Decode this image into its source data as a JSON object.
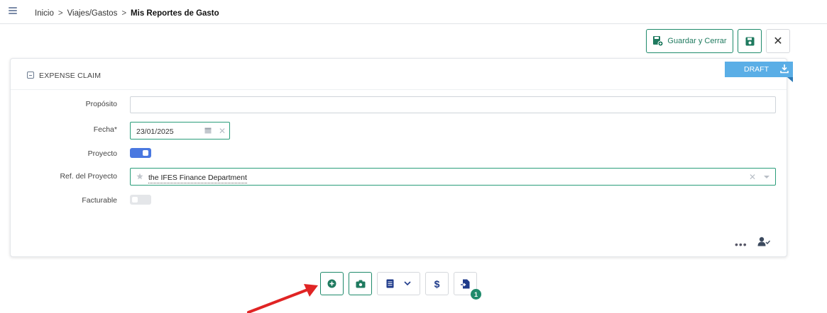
{
  "breadcrumb": {
    "home": "Inicio",
    "separator": ">",
    "parent": "Viajes/Gastos",
    "current": "Mis Reportes de Gasto"
  },
  "toolbar": {
    "save_close_label": "Guardar y Cerrar",
    "save_icon": "floppy-disk-icon",
    "close_label": "✕"
  },
  "status": {
    "label": "DRAFT",
    "icon": "download-icon"
  },
  "section": {
    "title": "EXPENSE CLAIM"
  },
  "form": {
    "purpose": {
      "label": "Propósito",
      "value": ""
    },
    "date": {
      "label": "Fecha*",
      "value": "23/01/2025"
    },
    "project": {
      "label": "Proyecto",
      "enabled": true
    },
    "project_ref": {
      "label": "Ref. del Proyecto",
      "value": "the IFES Finance Department"
    },
    "billable": {
      "label": "Facturable",
      "enabled": false
    }
  },
  "footer": {
    "more_label": "•••"
  },
  "bottom_toolbar": {
    "attachment_count": "1"
  },
  "colors": {
    "accent_green": "#1f8a6b",
    "toggle_blue": "#4a78e0",
    "draft_blue": "#5aaee6",
    "arrow_red": "#e02424"
  }
}
